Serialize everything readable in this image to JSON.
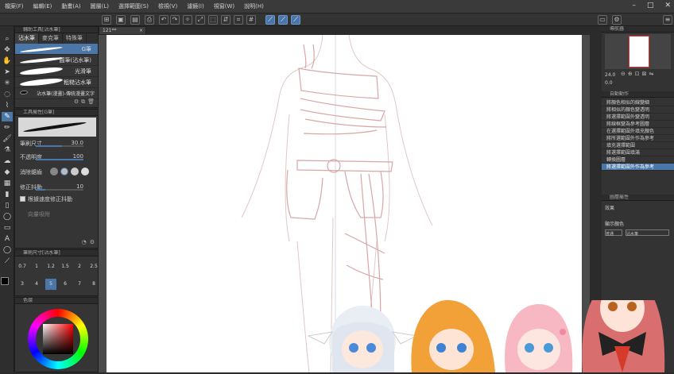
{
  "menu": [
    "檔案(F)",
    "編輯(E)",
    "動畫(A)",
    "圖層(L)",
    "選擇範圍(S)",
    "檢視(V)",
    "濾鏡(I)",
    "視窗(W)",
    "說明(H)"
  ],
  "window_buttons": [
    "–",
    "□",
    "✕"
  ],
  "document_tab": "121**",
  "subtool_panel": {
    "header": "輔助工具[沾水筆]",
    "tabs": [
      "沾水筆",
      "麥克筆",
      "特殊筆"
    ],
    "brushes": [
      {
        "label": "G筆",
        "selected": true
      },
      {
        "label": "圓筆(沾水筆)",
        "selected": false
      },
      {
        "label": "光滑筆",
        "selected": false
      },
      {
        "label": "粗糙沾水筆",
        "selected": false
      },
      {
        "label": "沾水筆(漫畫)-傳統漫畫文字",
        "selected": false
      }
    ]
  },
  "tool_property": {
    "header": "工具屬性[G筆]",
    "brush_size_label": "筆刷尺寸",
    "brush_size_value": "30.0",
    "brush_size_fill": 0.55,
    "opacity_label": "不透明度",
    "opacity_value": "100",
    "opacity_fill": 1.0,
    "antialias_label": "消除鋸齒",
    "stabilize_label": "修正抖動",
    "stabilize_value": "10",
    "stabilize_fill": 0.2,
    "vector_label": "根據速度修正抖動",
    "vector_magnet_label": "向量吸附"
  },
  "brush_size_panel": {
    "header": "筆刷尺寸[沾水筆]",
    "cells": [
      "0.7",
      "1",
      "1.2",
      "1.5",
      "2",
      "2.5",
      "3",
      "4",
      "5",
      "6",
      "7",
      "8"
    ]
  },
  "color_panel": {
    "header": "色環"
  },
  "navigator": {
    "header": "導航器",
    "zoom": "24.0",
    "angle": "0.0"
  },
  "auto_actions": {
    "header": "自動動作",
    "items": [
      "將顏色相似的線變細",
      "將相似的顏色變透明",
      "將選擇範圍外變透明",
      "將線框變為參考圖層",
      "在選擇範圍外填充顏色",
      "將所選範圍外作為參考",
      "填充選擇範圍",
      "將選擇範圍填滿",
      "轉換圖層",
      "將選擇範圍外作為參考"
    ],
    "selected_index": 9
  },
  "layer_property": {
    "header": "圖層屬性",
    "effect_label": "效果",
    "expression_label": "顯示顏色",
    "labels": [
      "普通",
      "沾水筆"
    ]
  },
  "characters": [
    "white-haired-chibi",
    "orange-haired-chibi",
    "pink-haired-chibi",
    "fox-eared-avatar"
  ]
}
